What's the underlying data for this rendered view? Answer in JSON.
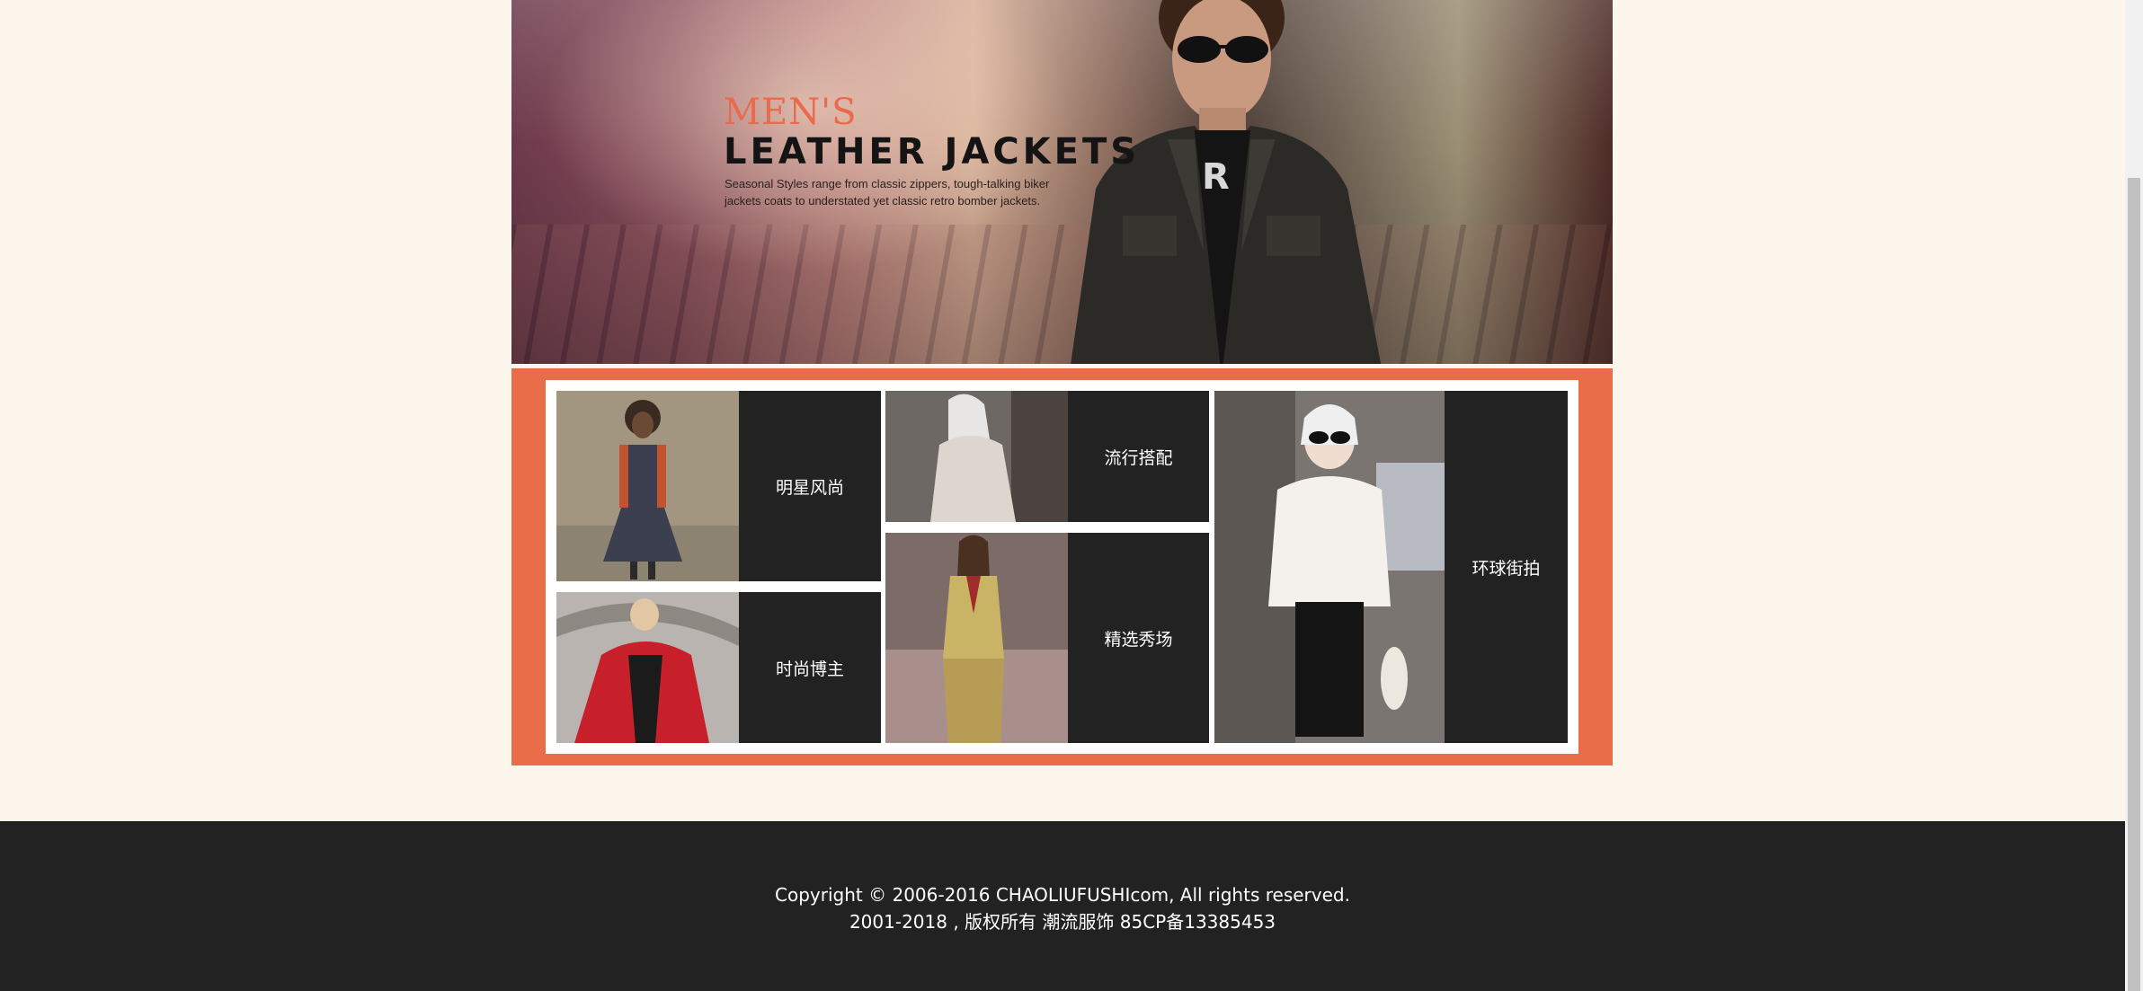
{
  "hero": {
    "headline_small": "MEN'S",
    "headline_large": "LEATHER JACKETS",
    "description": "Seasonal Styles range from classic zippers, tough-talking biker jackets coats to understated yet classic retro bomber jackets."
  },
  "categories": [
    {
      "label": "明星风尚"
    },
    {
      "label": "时尚博主"
    },
    {
      "label": "流行搭配"
    },
    {
      "label": "精选秀场"
    },
    {
      "label": "环球街拍"
    }
  ],
  "footer": {
    "copyright": "Copyright © 2006-2016 CHAOLIUFUSHIcom, All rights reserved.",
    "record": "2001-2018 , 版权所有 潮流服饰 85CP备13385453"
  },
  "colors": {
    "background": "#fdf6ec",
    "accent": "#e86d48",
    "dark": "#222222"
  }
}
